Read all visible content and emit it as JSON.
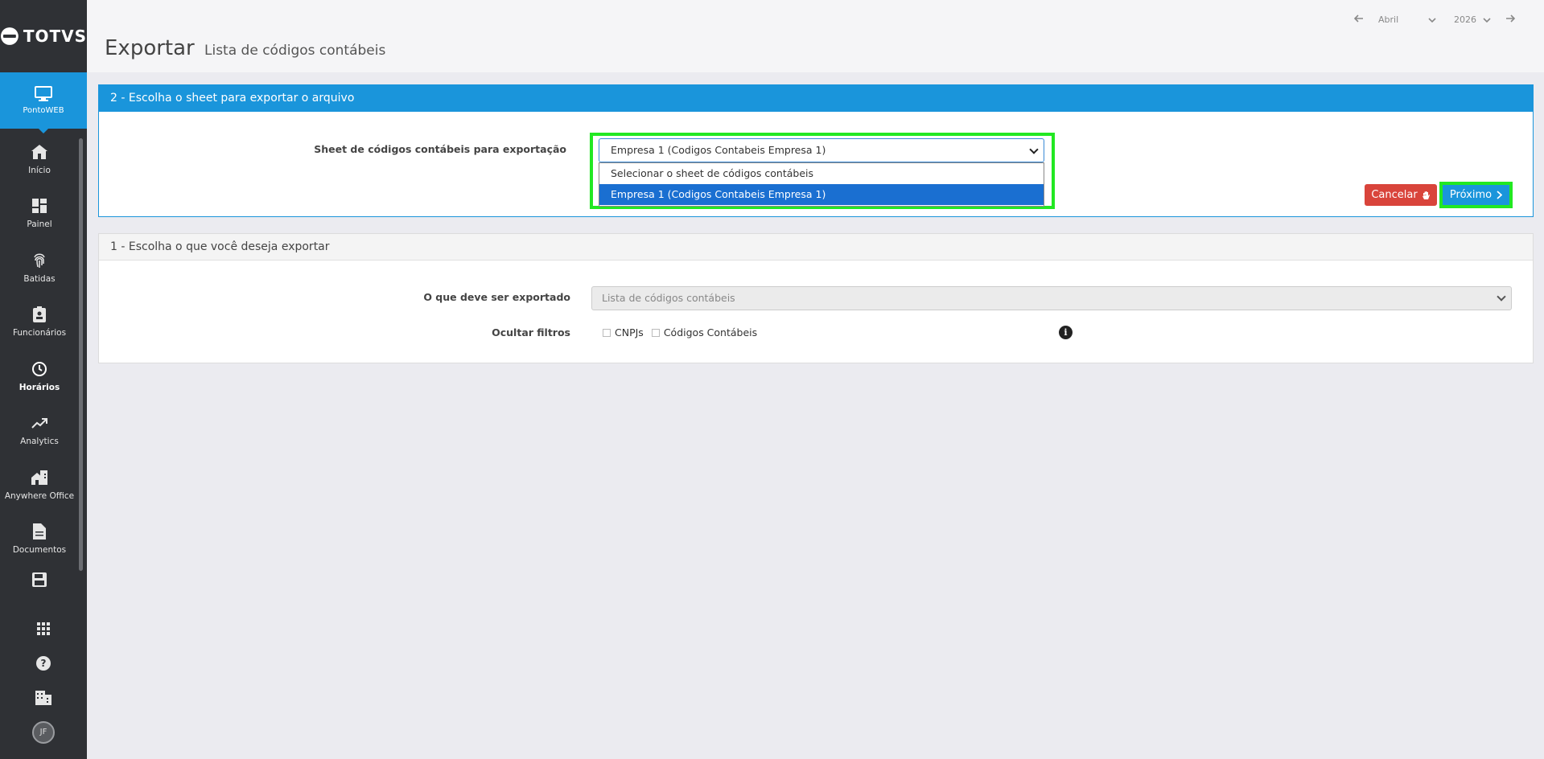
{
  "brand": {
    "logo_text": "TOTVS"
  },
  "sidebar": {
    "active_item": "PontoWEB",
    "items": [
      {
        "label": "Início",
        "icon": "home-icon"
      },
      {
        "label": "Painel",
        "icon": "dashboard-icon"
      },
      {
        "label": "Batidas",
        "icon": "fingerprint-icon"
      },
      {
        "label": "Funcionários",
        "icon": "badge-icon"
      },
      {
        "label": "Horários",
        "icon": "clock-icon"
      },
      {
        "label": "Analytics",
        "icon": "trending-up-icon"
      },
      {
        "label": "Anywhere Office",
        "icon": "home-work-icon"
      },
      {
        "label": "Documentos",
        "icon": "document-icon"
      }
    ],
    "avatar_initials": "JF"
  },
  "header": {
    "title": "Exportar",
    "subtitle": "Lista de códigos contábeis",
    "month": "Abril",
    "year": "2026"
  },
  "step2": {
    "heading": "2 - Escolha o sheet para exportar o arquivo",
    "field_label": "Sheet de códigos contábeis para exportação",
    "selected_value": "Empresa 1 (Codigos Contabeis Empresa 1)",
    "options": [
      "Selecionar o sheet de códigos contábeis",
      "Empresa 1 (Codigos Contabeis Empresa 1)"
    ],
    "cancel_label": "Cancelar",
    "next_label": "Próximo"
  },
  "step1": {
    "heading": "1 - Escolha o que você deseja exportar",
    "export_label": "O que deve ser exportado",
    "export_value": "Lista de códigos contábeis",
    "hide_filters_label": "Ocultar filtros",
    "filters": [
      "CNPJs",
      "Códigos Contábeis"
    ]
  },
  "colors": {
    "sidebar_bg": "#2f3135",
    "accent": "#1a95db",
    "danger": "#d9443b",
    "highlight": "#22e822",
    "option_selected": "#1a6fd1"
  }
}
